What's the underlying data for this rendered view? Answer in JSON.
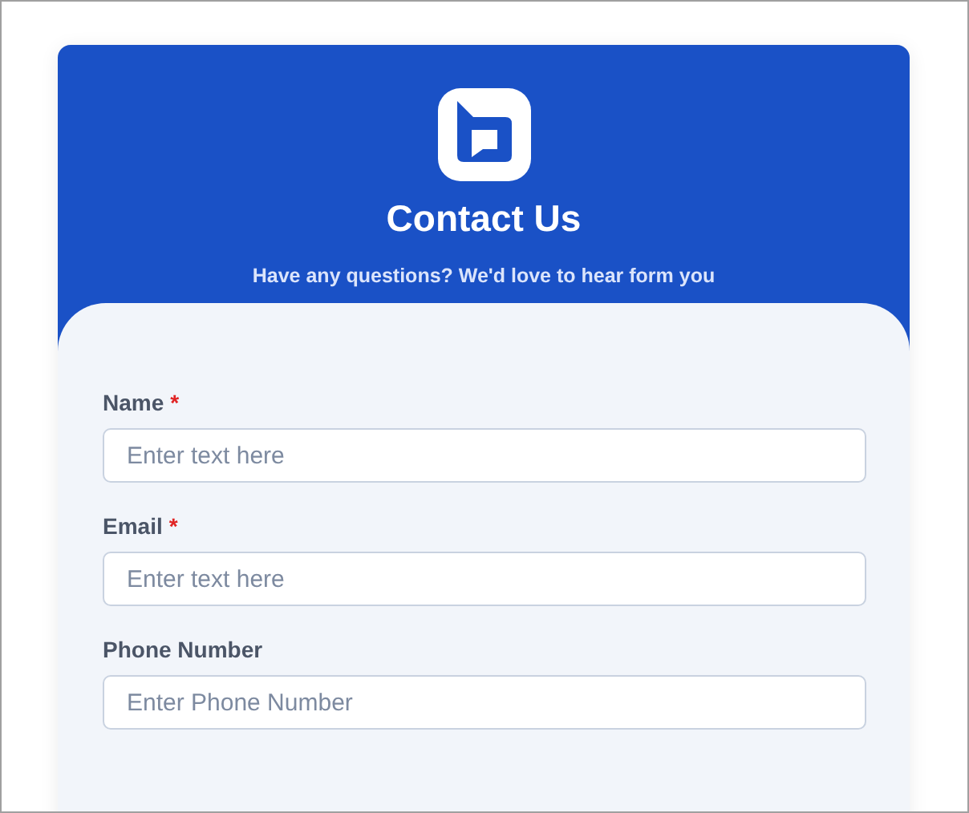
{
  "header": {
    "title": "Contact Us",
    "subtitle": "Have any questions? We'd love to hear form you"
  },
  "fields": [
    {
      "label": "Name",
      "required_mark": "*",
      "placeholder": "Enter text here"
    },
    {
      "label": "Email",
      "required_mark": "*",
      "placeholder": "Enter text here"
    },
    {
      "label": "Phone Number",
      "placeholder": "Enter Phone Number"
    }
  ]
}
